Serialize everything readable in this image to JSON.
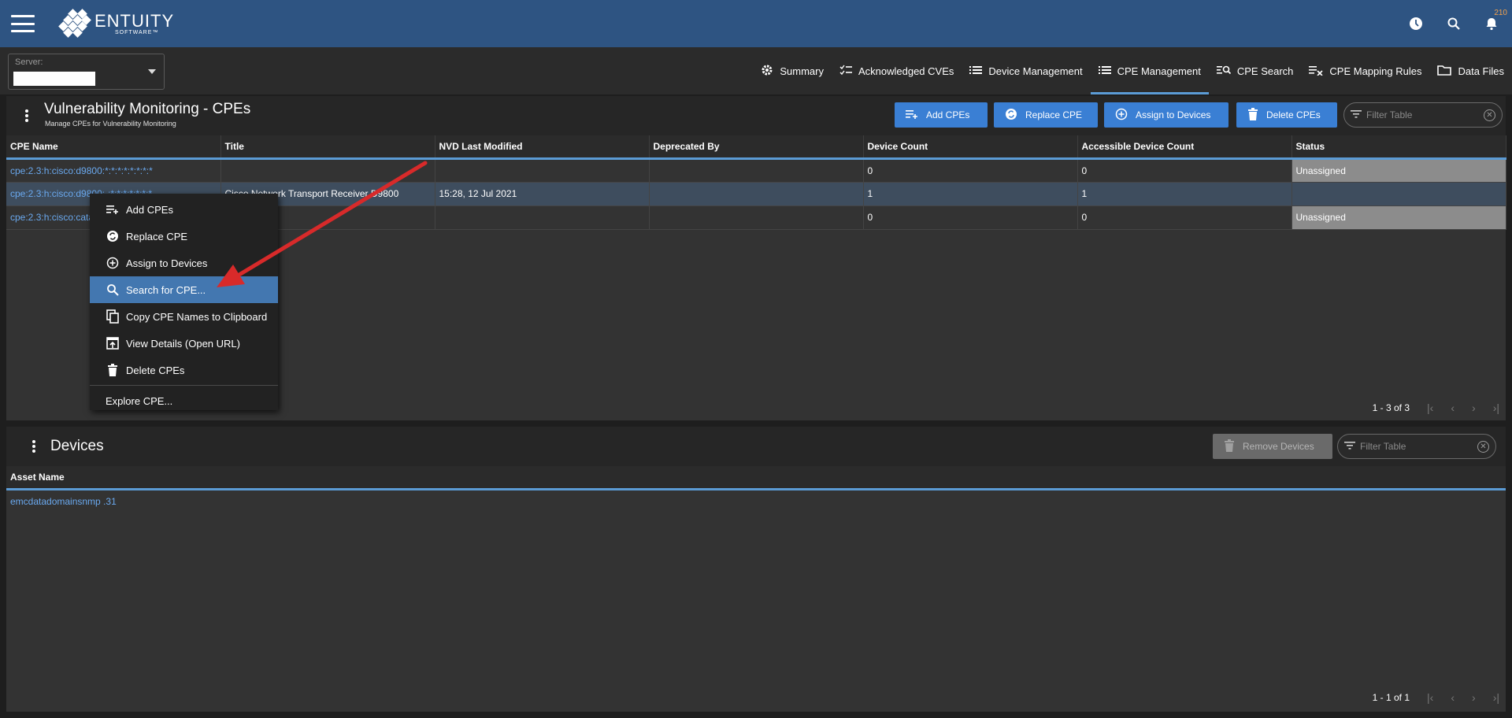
{
  "header": {
    "brand": "ENTUITY",
    "brand_sub": "SOFTWARE™",
    "notification_count": "210"
  },
  "subbar": {
    "server_label": "Server:",
    "tabs": [
      {
        "label": "Summary",
        "icon": "gear-icon",
        "active": false
      },
      {
        "label": "Acknowledged CVEs",
        "icon": "checklist-icon",
        "active": false
      },
      {
        "label": "Device Management",
        "icon": "list-icon",
        "active": false
      },
      {
        "label": "CPE Management",
        "icon": "list-icon",
        "active": true
      },
      {
        "label": "CPE Search",
        "icon": "search-list-icon",
        "active": false
      },
      {
        "label": "CPE Mapping Rules",
        "icon": "mapping-icon",
        "active": false
      },
      {
        "label": "Data Files",
        "icon": "folder-icon",
        "active": false
      }
    ]
  },
  "cpe_panel": {
    "title": "Vulnerability Monitoring - CPEs",
    "subtitle": "Manage CPEs for Vulnerability Monitoring",
    "buttons": {
      "add": "Add CPEs",
      "replace": "Replace CPE",
      "assign": "Assign to Devices",
      "delete": "Delete CPEs"
    },
    "filter_placeholder": "Filter Table",
    "columns": [
      "CPE Name",
      "Title",
      "NVD Last Modified",
      "Deprecated By",
      "Device Count",
      "Accessible Device Count",
      "Status"
    ],
    "rows": [
      {
        "cpe": "cpe:2.3:h:cisco:d9800:*:*:*:*:*:*:*:*",
        "title": "",
        "modified": "",
        "deprecated": "",
        "device_count": "0",
        "accessible": "0",
        "status": "Unassigned"
      },
      {
        "cpe": "cpe:2.3:h:cisco:d9800:-:*:*:*:*:*:*:*",
        "title": "Cisco Network Transport Receiver D9800",
        "modified": "15:28, 12 Jul 2021",
        "deprecated": "",
        "device_count": "1",
        "accessible": "1",
        "status": ""
      },
      {
        "cpe": "cpe:2.3:h:cisco:catalyst",
        "title": "",
        "modified": "",
        "deprecated": "",
        "device_count": "0",
        "accessible": "0",
        "status": "Unassigned"
      }
    ],
    "pager_text": "1 - 3 of 3"
  },
  "context_menu": {
    "items": [
      {
        "label": "Add CPEs",
        "icon": "playlist-add-icon"
      },
      {
        "label": "Replace CPE",
        "icon": "replace-icon"
      },
      {
        "label": "Assign to Devices",
        "icon": "add-circle-icon"
      },
      {
        "label": "Search for CPE...",
        "icon": "search-icon"
      },
      {
        "label": "Copy CPE Names to Clipboard",
        "icon": "copy-icon"
      },
      {
        "label": "View Details (Open URL)",
        "icon": "open-url-icon"
      },
      {
        "label": "Delete CPEs",
        "icon": "trash-icon"
      }
    ],
    "extra": "Explore CPE...",
    "highlighted": "Search for CPE..."
  },
  "devices_panel": {
    "title": "Devices",
    "remove_button": "Remove Devices",
    "filter_placeholder": "Filter Table",
    "columns": [
      "Asset Name"
    ],
    "rows": [
      {
        "asset": "emcdatadomainsnmp .31"
      }
    ],
    "pager_text": "1 - 1 of 1"
  },
  "colors": {
    "header_bg": "#2e5482",
    "accent": "#3a7fd4",
    "link": "#6aa9ef",
    "arrow": "#d82a2a"
  }
}
